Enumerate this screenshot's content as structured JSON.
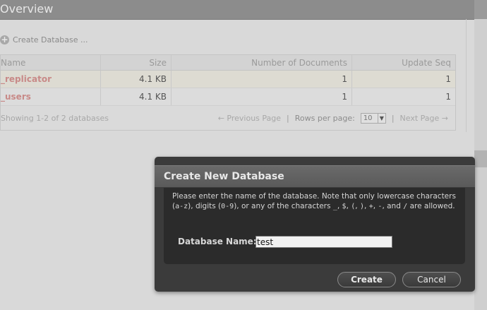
{
  "page": {
    "title": "Overview"
  },
  "toolbar": {
    "create_database_label": "Create Database ..."
  },
  "table": {
    "headers": [
      "Name",
      "Size",
      "Number of Documents",
      "Update Seq"
    ],
    "rows": [
      {
        "name": "_replicator",
        "size": "4.1 KB",
        "docs": "1",
        "seq": "1"
      },
      {
        "name": "_users",
        "size": "4.1 KB",
        "docs": "1",
        "seq": "1"
      }
    ]
  },
  "pagination": {
    "showing": "Showing 1-2 of 2 databases",
    "previous": "← Previous Page",
    "separator": "|",
    "rows_per_page_label": "Rows per page:",
    "rows_per_page_value": "10",
    "next": "Next Page →"
  },
  "dialog": {
    "title": "Create New Database",
    "instructions": {
      "p1": "Please enter the name of the database. Note that only lowercase characters (",
      "az": "a-z",
      "p2": "), digits (",
      "digits": "0-9",
      "p3": "), or any of the characters ",
      "underscore": "_",
      "c1": ", ",
      "dollar": "$",
      "c2": ", ",
      "lparen": "(",
      "c3": ", ",
      "rparen": ")",
      "c4": ", ",
      "plus": "+",
      "c5": ", ",
      "minus": "-",
      "c6": ", and ",
      "slash": "/",
      "p4": " are allowed."
    },
    "field_label": "Database Name:",
    "field_value": "test",
    "create_label": "Create",
    "cancel_label": "Cancel"
  },
  "icons": {
    "create": "plus-circle-icon",
    "select": "chevron-down-icon"
  }
}
